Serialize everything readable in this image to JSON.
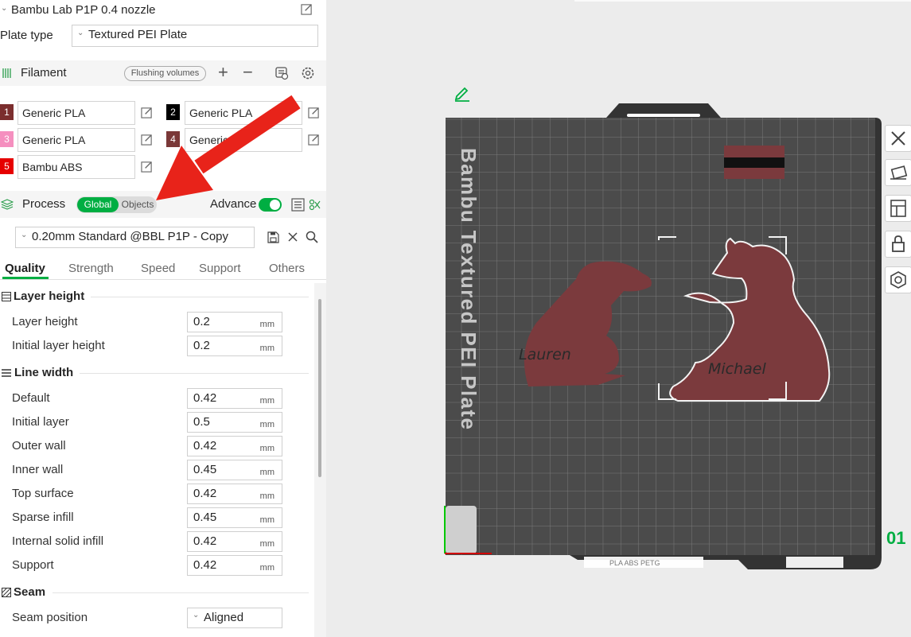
{
  "printer": {
    "name": "Bambu Lab P1P 0.4 nozzle"
  },
  "plate_type": {
    "label": "Plate type",
    "value": "Textured PEI Plate"
  },
  "filament": {
    "title": "Filament",
    "flushing_label": "Flushing volumes",
    "add_icon": "plus-icon",
    "remove_icon": "minus-icon",
    "items": [
      {
        "num": "1",
        "name": "Generic PLA",
        "color": "#7b2e2e"
      },
      {
        "num": "2",
        "name": "Generic PLA",
        "color": "#000000"
      },
      {
        "num": "3",
        "name": "Generic PLA",
        "color": "#f58fbf"
      },
      {
        "num": "4",
        "name": "Generic",
        "color": "#7a3838"
      },
      {
        "num": "5",
        "name": "Bambu ABS",
        "color": "#e60000"
      }
    ]
  },
  "process": {
    "title": "Process",
    "global_label": "Global",
    "objects_label": "Objects",
    "advance_label": "Advance",
    "preset": "0.20mm Standard @BBL P1P - Copy"
  },
  "tabs": [
    "Quality",
    "Strength",
    "Speed",
    "Support",
    "Others"
  ],
  "groups": {
    "layer_height": {
      "title": "Layer height",
      "params": [
        {
          "label": "Layer height",
          "value": "0.2",
          "unit": "mm"
        },
        {
          "label": "Initial layer height",
          "value": "0.2",
          "unit": "mm"
        }
      ]
    },
    "line_width": {
      "title": "Line width",
      "params": [
        {
          "label": "Default",
          "value": "0.42",
          "unit": "mm"
        },
        {
          "label": "Initial layer",
          "value": "0.5",
          "unit": "mm"
        },
        {
          "label": "Outer wall",
          "value": "0.42",
          "unit": "mm"
        },
        {
          "label": "Inner wall",
          "value": "0.45",
          "unit": "mm"
        },
        {
          "label": "Top surface",
          "value": "0.42",
          "unit": "mm"
        },
        {
          "label": "Sparse infill",
          "value": "0.45",
          "unit": "mm"
        },
        {
          "label": "Internal solid infill",
          "value": "0.42",
          "unit": "mm"
        },
        {
          "label": "Support",
          "value": "0.42",
          "unit": "mm"
        }
      ]
    },
    "seam": {
      "title": "Seam",
      "params": [
        {
          "label": "Seam position",
          "value": "Aligned"
        }
      ]
    }
  },
  "plate": {
    "vertical_label": "Bambu Textured PEI Plate",
    "plate_number": "01",
    "bottom_label": "PLA ABS PETG",
    "name_left": "Lauren",
    "name_right": "Michael"
  },
  "colors": {
    "accent": "#00ae42",
    "plate": "#4a4a4a",
    "model": "#7b3a3d",
    "arrow": "#e8231a"
  }
}
